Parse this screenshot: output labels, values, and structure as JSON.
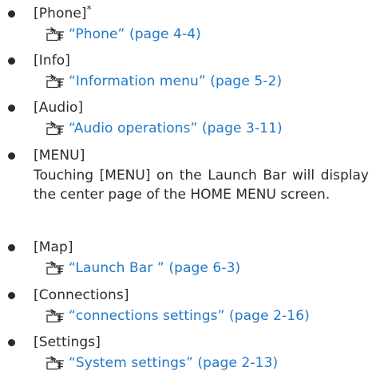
{
  "items": [
    {
      "label": "[Phone]",
      "label_suffix": "*",
      "ref": "“Phone” (page 4-4)"
    },
    {
      "label": "[Info]",
      "ref": "“Information menu” (page 5-2)"
    },
    {
      "label": "[Audio]",
      "ref": "“Audio operations” (page 3-11)"
    },
    {
      "label": "[MENU]",
      "text": "Touching [MENU] on the Launch Bar will display the center page of the HOME MENU screen."
    },
    {
      "label": "[Map]",
      "ref": "“Launch Bar ” (page 6-3)"
    },
    {
      "label": "[Connections]",
      "ref": "“connections settings” (page 2-16)"
    },
    {
      "label": "[Settings]",
      "ref": "“System settings” (page 2-13)"
    }
  ],
  "colors": {
    "text": "#2b2b2b",
    "link": "#1f78c8",
    "bullet": "#2b2b2b"
  },
  "icons": {
    "reference": "pointing-hand-reference-icon"
  }
}
